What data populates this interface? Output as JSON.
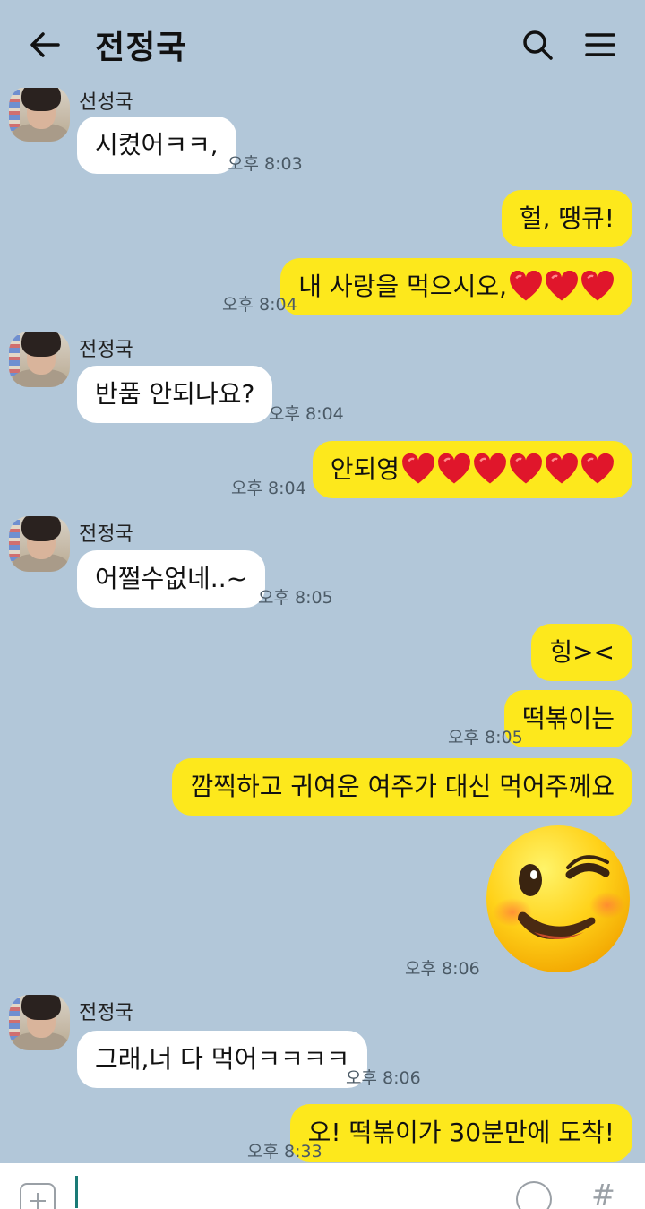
{
  "header": {
    "title": "전정국",
    "back_icon": "arrow-left-icon",
    "search_icon": "search-icon",
    "menu_icon": "menu-icon"
  },
  "colors": {
    "background": "#b2c7d9",
    "outgoing_bubble": "#fde81c",
    "incoming_bubble": "#ffffff",
    "heart": "#e0162b"
  },
  "messages": [
    {
      "sender": "선성국",
      "text": "시켰어ㅋㅋ,",
      "time": "오후 8:03",
      "dir": "in"
    },
    {
      "text": "헐, 땡큐!",
      "dir": "out"
    },
    {
      "text": "내 사랑을 먹으시오,",
      "hearts": 3,
      "time": "오후 8:04",
      "dir": "out"
    },
    {
      "sender": "전정국",
      "text": "반품 안되나요?",
      "time": "오후 8:04",
      "dir": "in"
    },
    {
      "text": "안되영",
      "hearts": 6,
      "time": "오후 8:04",
      "dir": "out"
    },
    {
      "sender": "전정국",
      "text": "어쩔수없네..~",
      "time": "오후 8:05",
      "dir": "in"
    },
    {
      "text": "힝><",
      "dir": "out"
    },
    {
      "text": "떡볶이는",
      "time": "오후 8:05",
      "dir": "out"
    },
    {
      "text": "깜찍하고 귀여운 여주가 대신 먹어주께요",
      "dir": "out"
    },
    {
      "emoji": "winking-face-emoji",
      "time": "오후 8:06",
      "dir": "out"
    },
    {
      "sender": "전정국",
      "text": "그래,너 다 먹어ㅋㅋㅋㅋ",
      "time": "오후 8:06",
      "dir": "in"
    },
    {
      "text": "오! 떡볶이가 30분만에 도착!",
      "time": "오후 8:33",
      "dir": "out"
    }
  ],
  "input": {
    "plus_icon": "plus-icon",
    "emoji_icon": "smiley-icon",
    "hash_symbol": "#"
  }
}
